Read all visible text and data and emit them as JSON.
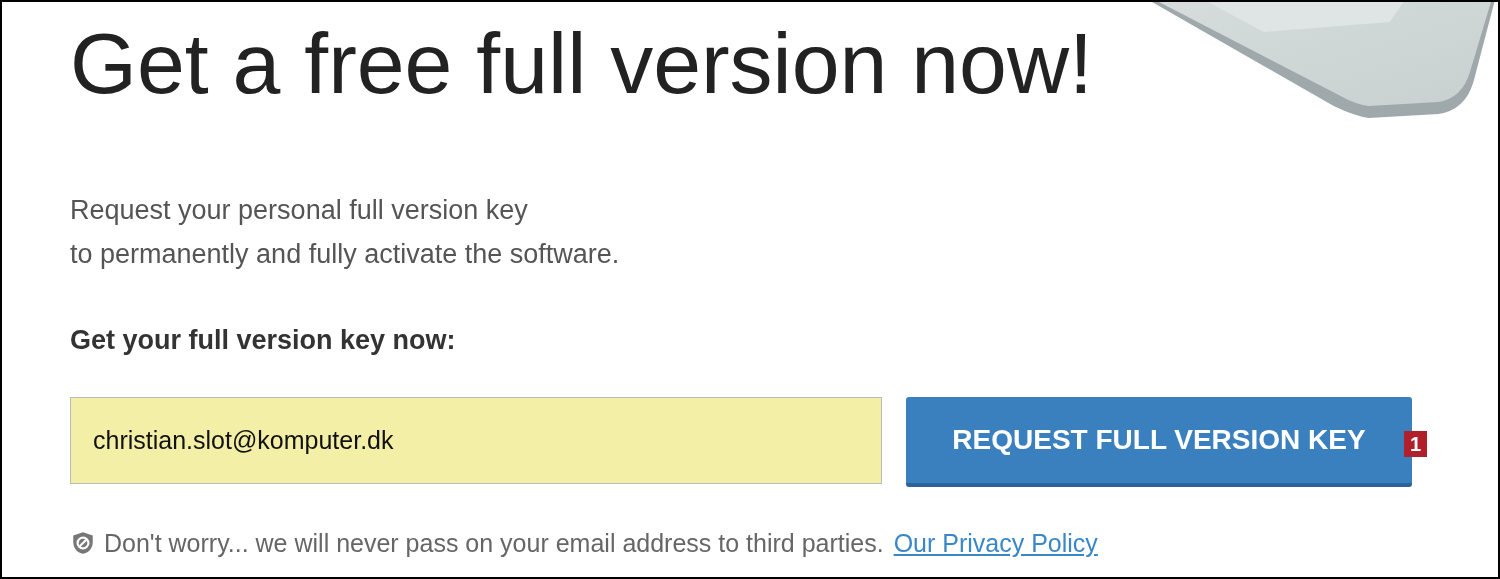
{
  "heading": "Get a free full version now!",
  "intro": [
    "Request your personal full version key",
    "to permanently and fully activate the software."
  ],
  "form_label": "Get your full version key now:",
  "email_field": {
    "value": "christian.slot@komputer.dk"
  },
  "request_button": {
    "label": "REQUEST FULL VERSION KEY"
  },
  "callout_badge": "1",
  "privacy_note": {
    "text": "Don't worry... we will never pass on your email address to third parties.",
    "link": "Our Privacy Policy"
  }
}
